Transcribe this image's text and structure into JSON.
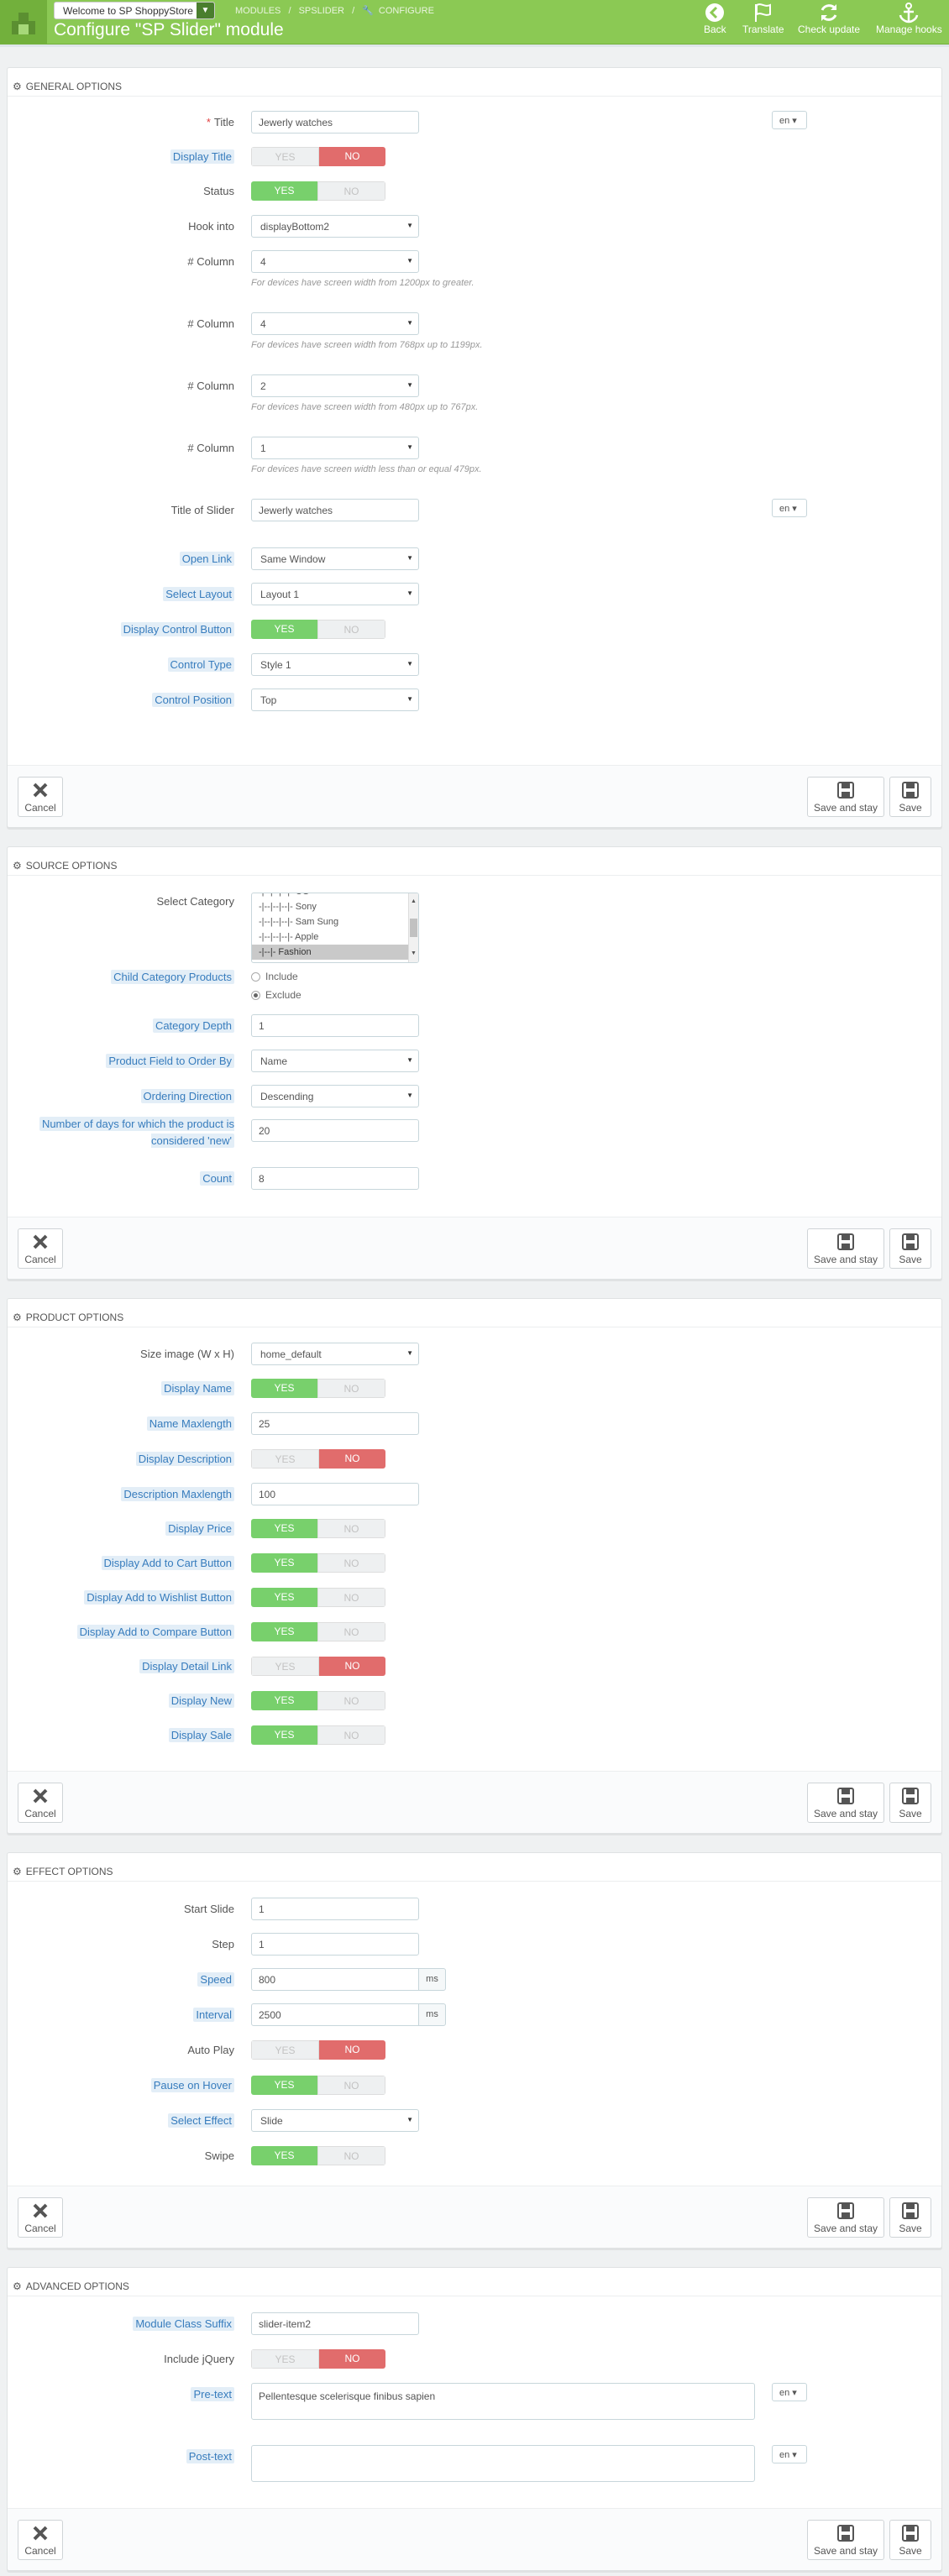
{
  "header": {
    "store_select": "Welcome to SP ShoppyStore",
    "breadcrumb": [
      "MODULES",
      "/",
      "SPSLIDER",
      "/",
      "CONFIGURE"
    ],
    "title": "Configure \"SP Slider\" module",
    "toolbar": {
      "back": "Back",
      "translate": "Translate",
      "check_update": "Check update",
      "manage_hooks": "Manage hooks"
    }
  },
  "footer": {
    "cancel": "Cancel",
    "save_stay": "Save and stay",
    "save": "Save"
  },
  "general": {
    "heading": "GENERAL OPTIONS",
    "title_label": "Title",
    "title_value": "Jewerly watches",
    "lang": "en",
    "display_title_label": "Display Title",
    "status_label": "Status",
    "hook_label": "Hook into",
    "hook_value": "displayBottom2",
    "col_label": "# Column",
    "col1_value": "4",
    "col1_help": "For devices have screen width from 1200px to greater.",
    "col2_value": "4",
    "col2_help": "For devices have screen width from 768px up to 1199px.",
    "col3_value": "2",
    "col3_help": "For devices have screen width from 480px up to 767px.",
    "col4_value": "1",
    "col4_help": "For devices have screen width less than or equal 479px.",
    "slider_title_label": "Title of Slider",
    "slider_title_value": "Jewerly watches",
    "open_link_label": "Open Link",
    "open_link_value": "Same Window",
    "layout_label": "Select Layout",
    "layout_value": "Layout 1",
    "control_btn_label": "Display Control Button",
    "control_type_label": "Control Type",
    "control_type_value": "Style 1",
    "control_pos_label": "Control Position",
    "control_pos_value": "Top"
  },
  "switch": {
    "yes": "YES",
    "no": "NO"
  },
  "source": {
    "heading": "SOURCE OPTIONS",
    "category_label": "Select Category",
    "category_items": [
      "-|--|--|--|- CG",
      "-|--|--|--|- Sony",
      "-|--|--|--|- Sam Sung",
      "-|--|--|--|- Apple",
      "-|--|- Fashion"
    ],
    "child_label": "Child Category Products",
    "include": "Include",
    "exclude": "Exclude",
    "depth_label": "Category Depth",
    "depth_value": "1",
    "order_by_label": "Product Field to Order By",
    "order_by_value": "Name",
    "order_dir_label": "Ordering Direction",
    "order_dir_value": "Descending",
    "new_days_label": "Number of days for which the product is considered 'new'",
    "new_days_value": "20",
    "count_label": "Count",
    "count_value": "8"
  },
  "product": {
    "heading": "PRODUCT OPTIONS",
    "size_label": "Size image (W x H)",
    "size_value": "home_default",
    "display_name_label": "Display Name",
    "name_max_label": "Name Maxlength",
    "name_max_value": "25",
    "display_desc_label": "Display Description",
    "desc_max_label": "Description Maxlength",
    "desc_max_value": "100",
    "price_label": "Display Price",
    "cart_label": "Display Add to Cart Button",
    "wishlist_label": "Display Add to Wishlist Button",
    "compare_label": "Display Add to Compare Button",
    "detail_label": "Display Detail Link",
    "new_label": "Display New",
    "sale_label": "Display Sale"
  },
  "effect": {
    "heading": "EFFECT OPTIONS",
    "start_label": "Start Slide",
    "start_value": "1",
    "step_label": "Step",
    "step_value": "1",
    "speed_label": "Speed",
    "speed_value": "800",
    "ms": "ms",
    "interval_label": "Interval",
    "interval_value": "2500",
    "autoplay_label": "Auto Play",
    "pause_label": "Pause on Hover",
    "effect_label": "Select Effect",
    "effect_value": "Slide",
    "swipe_label": "Swipe"
  },
  "advanced": {
    "heading": "ADVANCED OPTIONS",
    "suffix_label": "Module Class Suffix",
    "suffix_value": "slider-item2",
    "jquery_label": "Include jQuery",
    "pretext_label": "Pre-text",
    "pretext_value": "Pellentesque scelerisque finibus sapien",
    "posttext_label": "Post-text",
    "posttext_value": "",
    "lang": "en"
  },
  "colors": {
    "header": "#8bc954",
    "yes": "#78d06c",
    "no": "#e16c6c",
    "tip": "#377cbd"
  }
}
